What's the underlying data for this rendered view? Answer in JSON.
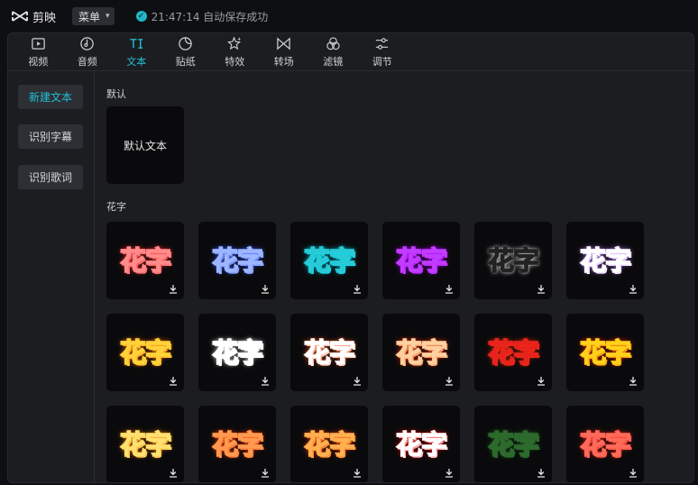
{
  "app": {
    "name": "剪映",
    "menu_label": "菜单",
    "save_status": "21:47:14 自动保存成功"
  },
  "tabs": [
    {
      "label": "视频",
      "icon": "video-icon",
      "active": false
    },
    {
      "label": "音频",
      "icon": "audio-icon",
      "active": false
    },
    {
      "label": "文本",
      "icon": "text-icon",
      "active": true
    },
    {
      "label": "贴纸",
      "icon": "sticker-icon",
      "active": false
    },
    {
      "label": "特效",
      "icon": "effects-icon",
      "active": false
    },
    {
      "label": "转场",
      "icon": "transition-icon",
      "active": false
    },
    {
      "label": "滤镜",
      "icon": "filter-icon",
      "active": false
    },
    {
      "label": "调节",
      "icon": "adjust-icon",
      "active": false
    }
  ],
  "sidebar": {
    "items": [
      {
        "label": "新建文本",
        "active": true
      },
      {
        "label": "识别字幕",
        "active": false
      },
      {
        "label": "识别歌词",
        "active": false
      }
    ]
  },
  "sections": {
    "default_title": "默认",
    "default_card_label": "默认文本",
    "huazi_title": "花字"
  },
  "huazi": {
    "text": "花字",
    "styles": [
      {
        "fill": "#ff3b3b",
        "stroke": "#ff8a8a",
        "glow": "#ff2a2a"
      },
      {
        "fill": "#3e6dff",
        "stroke": "#9db6ff",
        "glow": "#3c5dff"
      },
      {
        "fill": "#e8ffff",
        "stroke": "#29c9d6",
        "glow": "#00e5ff"
      },
      {
        "fill": "#ffffff",
        "stroke": "#c13cff",
        "glow": "#b400ff"
      },
      {
        "fill": "#ffffff",
        "stroke": "#222222",
        "glow": "#ffffff"
      },
      {
        "fill": "#ffb6c8",
        "stroke": "#ffffff",
        "glow": "#c080ff"
      },
      {
        "fill": "#ff4a3a",
        "stroke": "#ffd23a",
        "glow": "#ff7a00"
      },
      {
        "fill": "#e8231e",
        "stroke": "#ffffff",
        "glow": "#ffffff"
      },
      {
        "fill": "#ff7a3a",
        "stroke": "#ffffff",
        "glow": "#ff5a1e"
      },
      {
        "fill": "#ff5a1e",
        "stroke": "#ffd0a0",
        "glow": "#ff3a00"
      },
      {
        "fill": "#ffe21a",
        "stroke": "#e8231e",
        "glow": "#ff3300"
      },
      {
        "fill": "#e8231e",
        "stroke": "#ffd21a",
        "glow": "#ff3300"
      },
      {
        "fill": "#ffb21a",
        "stroke": "#ffe070",
        "glow": "#ff8800"
      },
      {
        "fill": "#ff5a28",
        "stroke": "#ff9a50",
        "glow": "#ff3c00"
      },
      {
        "fill": "#ff6a1a",
        "stroke": "#ffb050",
        "glow": "#ff4400"
      },
      {
        "fill": "#e8231e",
        "stroke": "#ffffff",
        "glow": "#ff0000"
      },
      {
        "fill": "#4aa84a",
        "stroke": "#2d6a2d",
        "glow": "#2a6a2a"
      },
      {
        "fill": "#e8322a",
        "stroke": "#ff6a5a",
        "glow": "#ff2a1a"
      }
    ]
  }
}
